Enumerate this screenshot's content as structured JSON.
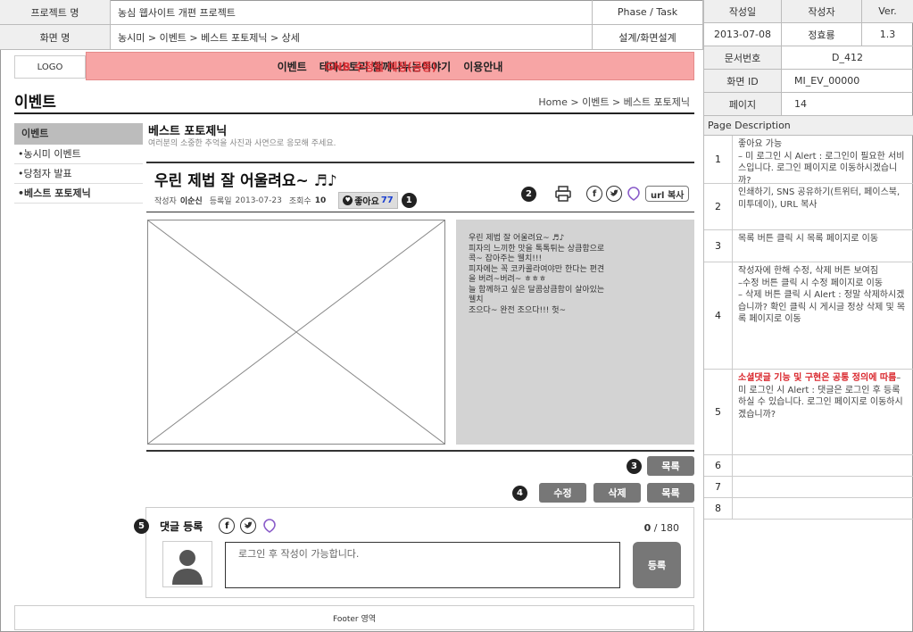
{
  "header": {
    "project_label": "프로젝트 명",
    "project_value": "농심 웹사이트 개편 프로젝트",
    "phase_label": "Phase / Task",
    "screen_label": "화면 명",
    "screen_value": "농시미 > 이벤트 > 베스트 포토제닉 > 상세",
    "phase_value": "설계/화면설계"
  },
  "meta": {
    "author_date_label": "작성일",
    "author_label": "작성자",
    "ver_label": "Ver.",
    "date": "2013-07-08",
    "author": "정효룡",
    "version": "1.3",
    "doc_no_label": "문서번호",
    "doc_no": "D_412",
    "screen_id_label": "화면 ID",
    "screen_id": "MI_EV_00000",
    "page_label": "페이지",
    "page": "14"
  },
  "page_description": {
    "title": "Page Description",
    "rows": [
      {
        "num": "1",
        "text": "좋아요 가능\n– 미 로그인 시 Alert : 로그인이 필요한 서비스입니다. 로그인 페이지로 이동하시겠습니까?"
      },
      {
        "num": "2",
        "text": "인쇄하기, SNS 공유하기(트위터, 페이스북, 미투데이), URL 복사"
      },
      {
        "num": "3",
        "text": "목록 버튼 클릭 시 목록 페이지로 이동"
      },
      {
        "num": "4",
        "text": "작성자에 한해 수정, 삭제 버튼 보여짐\n–수정 버튼 클릭 시 수정 페이지로 이동\n– 삭제 버튼 클릭 시 Alert : 정말 삭제하시겠습니까? 확인 클릭 시 게시글 정상 삭제 및 목록 페이지로 이동"
      },
      {
        "num": "5",
        "highlight": "소셜댓글 기능 및 구현은 공통 정의에 따름",
        "text": "– 미 로그인 시 Alert : 댓글은 로그인 후 등록하실 수 있습니다. 로그인 페이지로 이동하시겠습니까?"
      },
      {
        "num": "6",
        "text": ""
      },
      {
        "num": "7",
        "text": ""
      },
      {
        "num": "8",
        "text": ""
      }
    ]
  },
  "gnb": {
    "logo": "LOGO",
    "items": [
      "이벤트",
      "테마스토리",
      "함께나누는이야기",
      "이용안내"
    ],
    "overlay": "GNB 수정될 예정(공통)"
  },
  "page": {
    "title": "이벤트",
    "breadcrumb": "Home > 이벤트 > 베스트 포토제닉"
  },
  "sidebar": {
    "head": "이벤트",
    "items": [
      "•농시미 이벤트",
      "•당첨자 발표",
      "•베스트 포토제닉"
    ]
  },
  "section": {
    "title": "베스트 포토제닉",
    "subtitle": "여러분의 소중한 추억을 사진과 사연으로 응모해 주세요."
  },
  "post": {
    "title": "우린 제법 잘 어울려요~ ♬♪",
    "writer_label": "작성자",
    "writer": "이순신",
    "date_label": "등록일",
    "date": "2013-07-23",
    "views_label": "조회수",
    "views": "10",
    "like_label": "좋아요",
    "like_count": "77",
    "url_copy": "url 복사",
    "body": "우린 제법 잘 어울려요~ ♬♪\n피자의 느끼한 맛을 톡톡튀는 상큼함으로\n콕~ 잡아주는 웰치!!!\n피자에는 꼭 코카콜라여야만 한다는 편견\n을 버려~버려~ ㅎㅎㅎ\n늘 함께하고 싶은 달콤상큼함이 살아있는\n웰치\n조으다~ 완전 조으다!!! 헛~"
  },
  "buttons": {
    "list": "목록",
    "edit": "수정",
    "delete": "삭제",
    "register": "등록"
  },
  "badges": [
    "1",
    "2",
    "3",
    "4",
    "5"
  ],
  "comment": {
    "title": "댓글 등록",
    "count": "0",
    "max": " / 180",
    "placeholder": "로그인 후 작성이 가능합니다."
  },
  "footer": {
    "label": "Footer 영역"
  },
  "colors": {
    "gnb_bg": "#f7a5a5",
    "highlight": "#d9262c",
    "like_count": "#1a3fd0",
    "button": "#777777"
  }
}
